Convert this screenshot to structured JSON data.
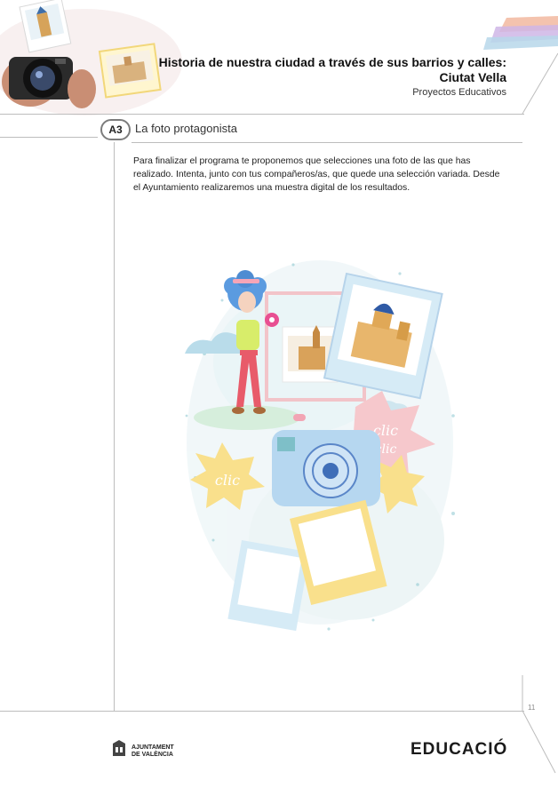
{
  "header": {
    "title_line1": "Historia de nuestra ciudad a través de sus barrios y calles:",
    "title_line2": "Ciutat Vella",
    "subtitle": "Proyectos Educativos"
  },
  "section": {
    "badge": "A3",
    "title": "La foto protagonista"
  },
  "body": {
    "paragraph": "Para finalizar el programa te proponemos que selecciones una foto de las que has realizado. Intenta, junto con tus compañeros/as, que quede una selección variada. Desde el Ayuntamiento realizaremos una muestra digital de los resultados."
  },
  "illustration": {
    "star_text_left": "clic",
    "star_text_right_1": "clic",
    "star_text_right_2": "clic"
  },
  "footer": {
    "page_number": "11",
    "ayuntamiento_line1": "AJUNTAMENT",
    "ayuntamiento_line2": "DE VALÈNCIA",
    "educacio": "EDUCACIÓ"
  }
}
